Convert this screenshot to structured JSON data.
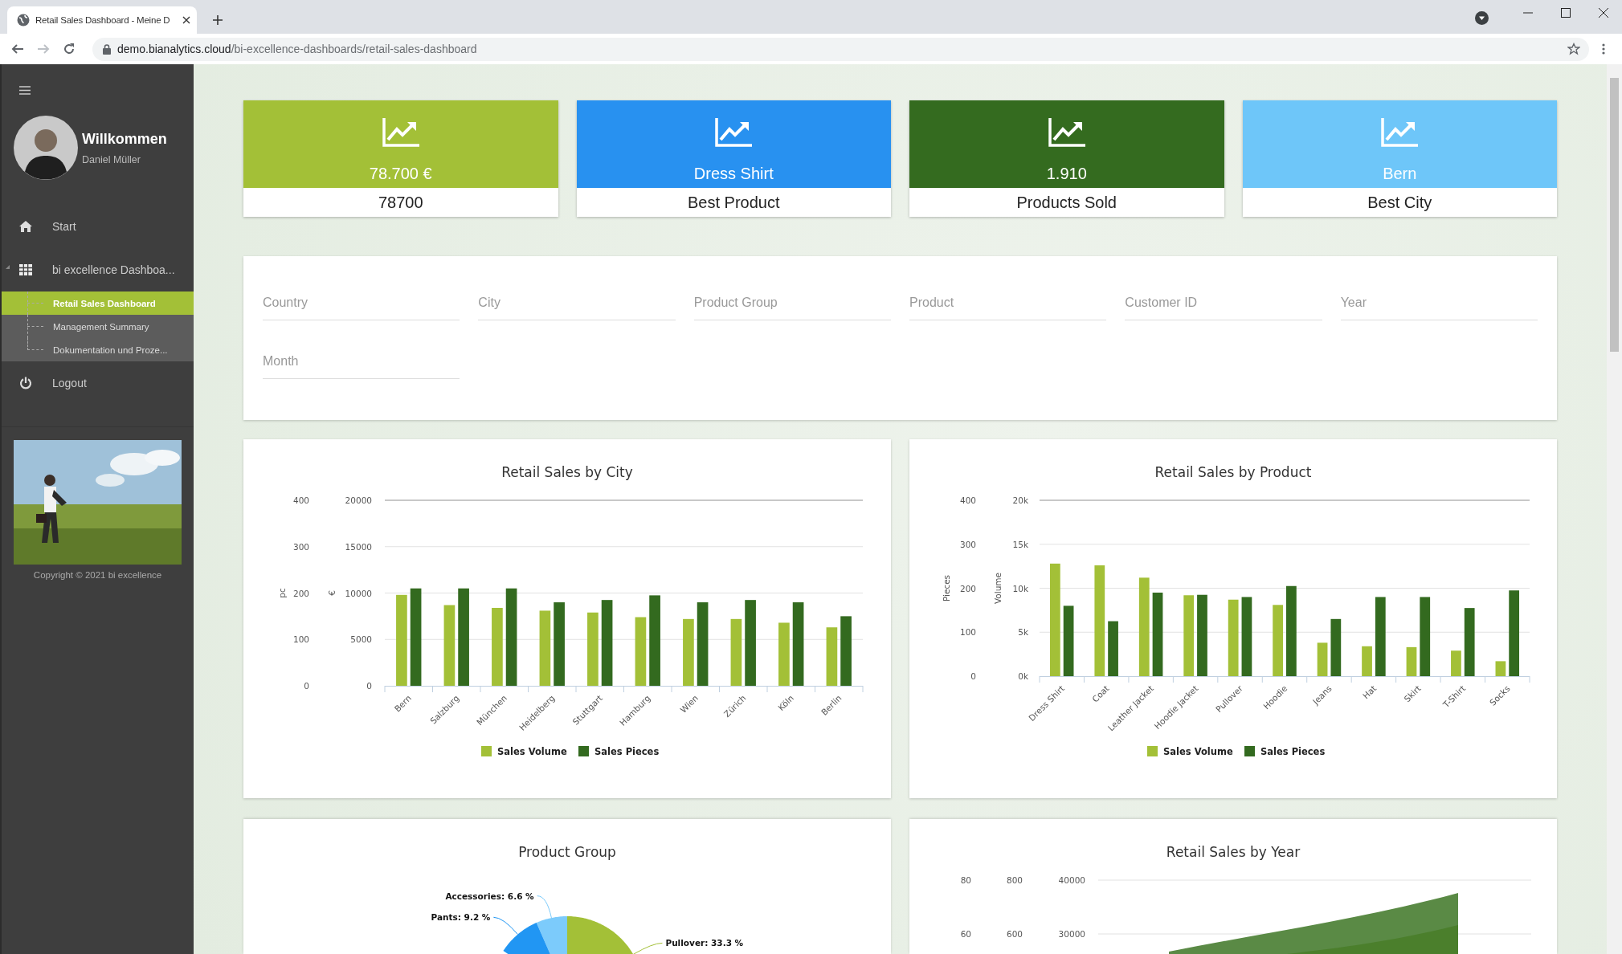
{
  "browser": {
    "tabs": [
      {
        "title": "Retail Sales Dashboard - Meine D",
        "selected": true
      }
    ],
    "nav_buttons": [
      {
        "kind": "back",
        "disabled": false
      },
      {
        "kind": "forward",
        "disabled": true
      },
      {
        "kind": "reload",
        "disabled": false
      }
    ],
    "url": {
      "host": "demo.bianalytics.cloud",
      "path": "/bi-excellence-dashboards/retail-sales-dashboard"
    }
  },
  "sidebar": {
    "user": {
      "greeting": "Willkommen",
      "name": "Daniel Müller"
    },
    "menu": [
      {
        "kind": "home",
        "label": "Start",
        "expanded": false
      },
      {
        "kind": "grid",
        "label": "bi excellence Dashboa...",
        "expanded": true,
        "children": [
          {
            "label": "Retail Sales Dashboard",
            "selected": true
          },
          {
            "label": "Management Summary",
            "selected": false
          },
          {
            "label": "Dokumentation und Proze...",
            "selected": false
          }
        ]
      },
      {
        "kind": "power",
        "label": "Logout",
        "expanded": false
      }
    ],
    "copyright": "Copyright © 2021 bi excellence"
  },
  "kpis": [
    {
      "value": "78.700 €",
      "label": "78700",
      "color": "#a3c037"
    },
    {
      "value": "Dress Shirt",
      "label": "Best Product",
      "color": "#2891f0"
    },
    {
      "value": "1.910",
      "label": "Products Sold",
      "color": "#346b1f"
    },
    {
      "value": "Bern",
      "label": "Best City",
      "color": "#6ec6f9"
    }
  ],
  "filters": [
    {
      "placeholder": "Country"
    },
    {
      "placeholder": "City"
    },
    {
      "placeholder": "Product Group"
    },
    {
      "placeholder": "Product"
    },
    {
      "placeholder": "Customer ID"
    },
    {
      "placeholder": "Year"
    },
    {
      "placeholder": "Month"
    }
  ],
  "panels": [
    {
      "chart_data": {
        "type": "bar",
        "title": "Retail Sales by City",
        "ylabel": "€",
        "y2label": "pc",
        "stacked": false,
        "grid": true,
        "legend": "bottom",
        "categories": [
          "Bern",
          "Salzburg",
          "München",
          "Heidelberg",
          "Stuttgart",
          "Hamburg",
          "Wien",
          "Zürich",
          "Köln",
          "Berlin"
        ],
        "ylim": [
          0,
          20000
        ],
        "yticks": [
          0,
          5000,
          10000,
          15000,
          20000
        ],
        "y2lim": [
          0,
          400
        ],
        "y2ticks": [
          0,
          100,
          200,
          300,
          400
        ],
        "series": [
          {
            "name": "Sales Volume",
            "color": "#a3c037",
            "values": [
              9800,
              8700,
              8400,
              8100,
              7900,
              7400,
              7200,
              7200,
              6800,
              6300
            ]
          },
          {
            "name": "Sales Pieces",
            "color": "#336a1f",
            "axis": "y2",
            "values": [
              210,
              210,
              210,
              180,
              185,
              195,
              180,
              185,
              180,
              150
            ]
          }
        ]
      }
    },
    {
      "chart_data": {
        "type": "bar",
        "title": "Retail Sales by Product",
        "ylabel": "Volume",
        "y2label": "Pieces",
        "stacked": false,
        "grid": true,
        "legend": "bottom",
        "categories": [
          "Dress Shirt",
          "Coat",
          "Leather Jacket",
          "Hoodie Jacket",
          "Pullover",
          "Hoodie",
          "Jeans",
          "Hat",
          "Skirt",
          "T-Shirt",
          "Socks"
        ],
        "ylim": [
          0,
          20000
        ],
        "yticks": [
          {
            "value": 0,
            "label": "0k"
          },
          {
            "value": 5000,
            "label": "5k"
          },
          {
            "value": 10000,
            "label": "10k"
          },
          {
            "value": 15000,
            "label": "15k"
          },
          {
            "value": 20000,
            "label": "20k"
          }
        ],
        "y2lim": [
          0,
          400
        ],
        "y2ticks": [
          0,
          100,
          200,
          300,
          400
        ],
        "series": [
          {
            "name": "Sales Volume",
            "color": "#a3c037",
            "values": [
              12800,
              12600,
              11200,
              9200,
              8700,
              8100,
              3800,
              3400,
              3300,
              2900,
              1700
            ]
          },
          {
            "name": "Sales Pieces",
            "color": "#336a1f",
            "axis": "y2",
            "values": [
              160,
              125,
              190,
              185,
              180,
              205,
              130,
              180,
              180,
              155,
              195
            ]
          }
        ]
      }
    },
    {
      "title": "Product Group",
      "slices": [
        {
          "label": "Accessories: 6.6 %",
          "color": "#7ccbfb"
        },
        {
          "label": "Pants: 9.2 %",
          "color": "#2196f3"
        },
        {
          "label": "Pullover: 33.3 %",
          "color": "#a3c037"
        }
      ]
    },
    {
      "title": "Retail Sales by Year",
      "axes": [
        {
          "ticks": [
            "80",
            "60"
          ]
        },
        {
          "ticks": [
            "800",
            "600"
          ]
        },
        {
          "ticks": [
            "40000",
            "30000"
          ]
        }
      ]
    }
  ]
}
